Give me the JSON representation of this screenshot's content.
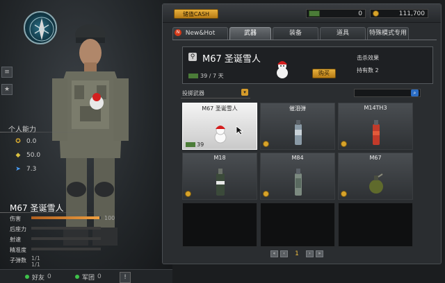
{
  "left": {
    "section_title": "个人能力",
    "abilities": [
      {
        "icon": "rank-icon",
        "value": "0.0"
      },
      {
        "icon": "experience-icon",
        "value": "50.0"
      },
      {
        "icon": "runner-icon",
        "value": "7.3"
      }
    ],
    "weapon_name": "M67 圣诞雪人",
    "weapon_stats": [
      {
        "label": "伤害",
        "value": "100",
        "fill": 0.98
      },
      {
        "label": "后座力",
        "fill": 0
      },
      {
        "label": "射速",
        "fill": 0
      },
      {
        "label": "精准度",
        "fill": 0
      },
      {
        "label": "子弹数",
        "value": "1/1"
      }
    ],
    "ammo_extra": "1/1"
  },
  "bottom_bar": {
    "friends_label": "好友",
    "friends_count": "0",
    "clan_label": "军团",
    "clan_count": "0"
  },
  "shop": {
    "cash_button": "储值CASH",
    "cash_amount": "0",
    "coin_amount": "111,700",
    "tabs": [
      "New&Hot",
      "武器",
      "装备",
      "道具",
      "特殊模式专用"
    ],
    "active_tab": 1,
    "detail": {
      "name": "M67 圣诞雪人",
      "ammo": "39 / 7 天",
      "buy_label": "购买",
      "effect_label": "击杀效果",
      "hold_label": "持有数 2"
    },
    "filter_label": "投掷武器",
    "items": [
      {
        "name": "M67 圣诞雪人",
        "count": "39",
        "selected": true
      },
      {
        "name": "催泪弹"
      },
      {
        "name": "M14TH3"
      },
      {
        "name": "M18"
      },
      {
        "name": "M84"
      },
      {
        "name": "M67"
      }
    ],
    "page": "1"
  }
}
